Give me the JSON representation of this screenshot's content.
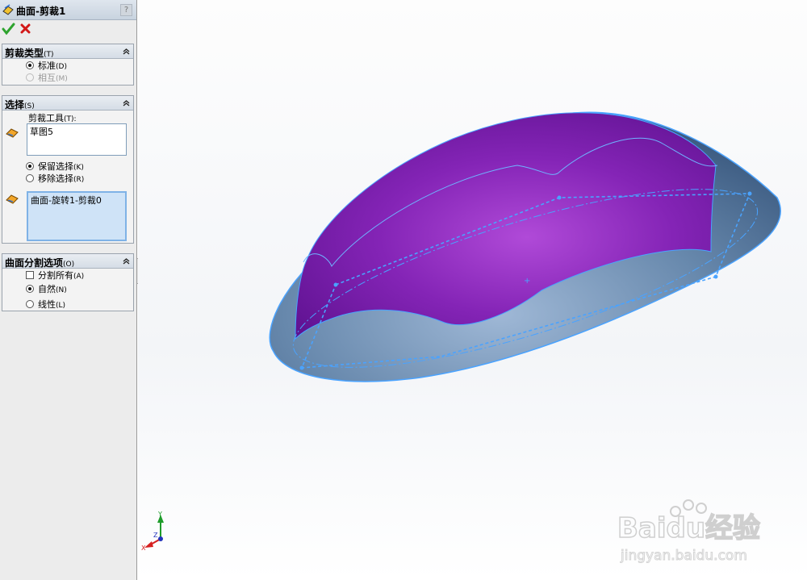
{
  "property_manager": {
    "title": "曲面-剪裁1",
    "help_label": "?",
    "icons": {
      "title": "surface-trim-icon",
      "ok": "check-icon",
      "cancel": "x-icon"
    },
    "trim_type": {
      "title": "剪裁类型",
      "title_key": "(T)",
      "options": [
        {
          "label": "标准",
          "key": "(D)",
          "selected": true,
          "enabled": true
        },
        {
          "label": "相互",
          "key": "(M)",
          "selected": false,
          "enabled": false
        }
      ]
    },
    "selections": {
      "title": "选择",
      "title_key": "(S)",
      "trim_tool_label": "剪裁工具",
      "trim_tool_key": "(T):",
      "trim_tool_value": "草图5",
      "options": [
        {
          "label": "保留选择",
          "key": "(K)",
          "selected": true
        },
        {
          "label": "移除选择",
          "key": "(R)",
          "selected": false
        }
      ],
      "pieces_value": "曲面-旋转1-剪裁0"
    },
    "split_options": {
      "title": "曲面分割选项",
      "title_key": "(O)",
      "split_all": {
        "label": "分割所有",
        "key": "(A)",
        "checked": false
      },
      "options": [
        {
          "label": "自然",
          "key": "(N)",
          "selected": true
        },
        {
          "label": "线性",
          "key": "(L)",
          "selected": false
        }
      ]
    }
  },
  "viewport": {
    "surface_color": "#7a1fa2",
    "back_color": "#5b7fa3",
    "edge_color": "#4aa3ff",
    "triad": {
      "x_label": "X",
      "y_label": "Y",
      "z_label": "Z"
    }
  },
  "watermark": {
    "logo": "Baidu经验",
    "url": "jingyan.baidu.com"
  }
}
